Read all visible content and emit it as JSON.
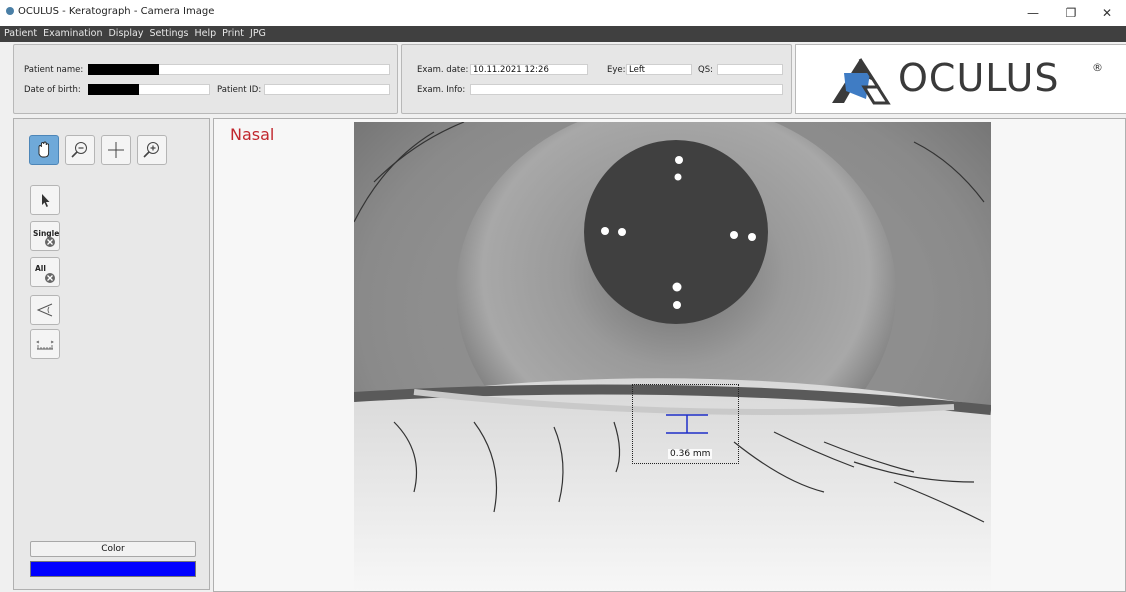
{
  "window": {
    "title": "OCULUS - Keratograph - Camera Image",
    "min_glyph": "—",
    "restore_glyph": "❐",
    "close_glyph": "✕"
  },
  "menu": [
    "Patient",
    "Examination",
    "Display",
    "Settings",
    "Help",
    "Print",
    "JPG"
  ],
  "patient": {
    "name_label": "Patient name:",
    "dob_label": "Date of birth:",
    "id_label": "Patient ID:",
    "id_value": ""
  },
  "exam": {
    "date_label": "Exam. date:",
    "date_value": "10.11.2021 12:26",
    "eye_label": "Eye:",
    "eye_value": "Left",
    "qs_label": "QS:",
    "qs_value": "",
    "info_label": "Exam. Info:",
    "info_value": ""
  },
  "logo": {
    "text": "OCULUS",
    "reg": "®"
  },
  "tools": {
    "top": [
      "hand-icon",
      "zoom-out-icon",
      "crosshair-icon",
      "zoom-in-icon"
    ],
    "side": [
      "pointer-icon",
      "delete-single-icon",
      "delete-all-icon",
      "angle-icon",
      "ruler-icon"
    ],
    "single_label": "Single",
    "all_label": "All",
    "color_label": "Color",
    "color_value": "#0000ff"
  },
  "viewer": {
    "side_label": "Nasal",
    "measurement_label": "0.36 mm",
    "measure_color": "#1f2fc8"
  }
}
